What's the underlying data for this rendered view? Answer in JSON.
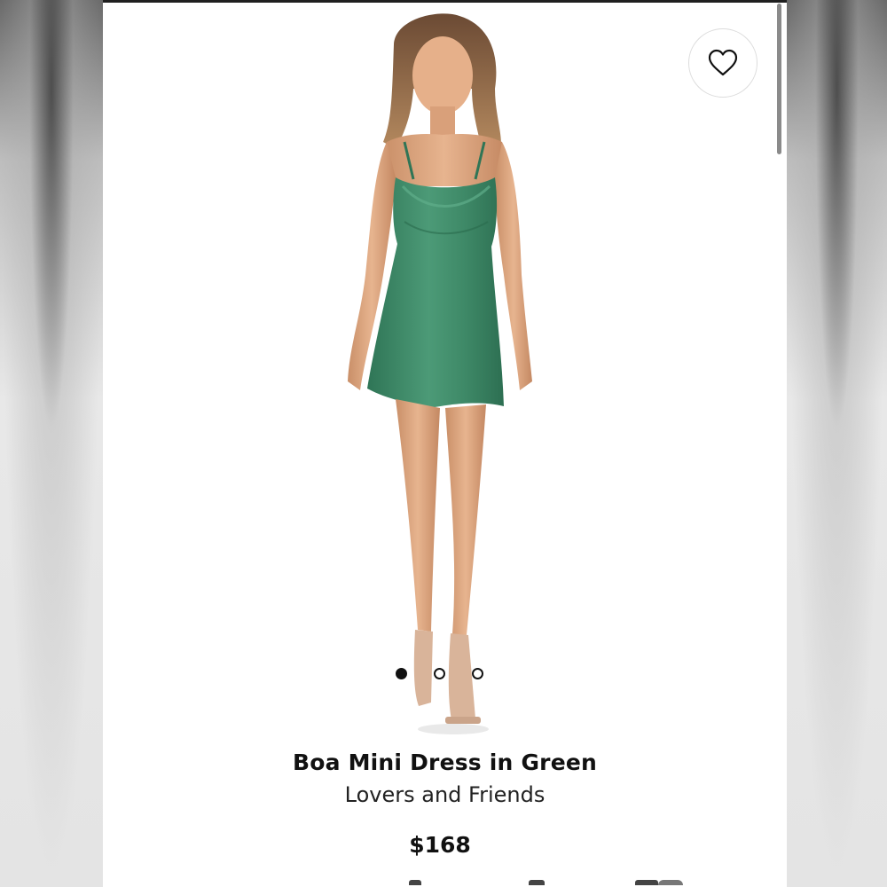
{
  "product": {
    "title": "Boa Mini Dress in Green",
    "brand": "Lovers and Friends",
    "price": "$168"
  },
  "carousel": {
    "total_images": 3,
    "active_index": 0
  },
  "icons": {
    "favorite": "heart-outline-icon"
  },
  "colors": {
    "dress": "#3f8a68",
    "background": "#ffffff",
    "text": "#111111"
  }
}
